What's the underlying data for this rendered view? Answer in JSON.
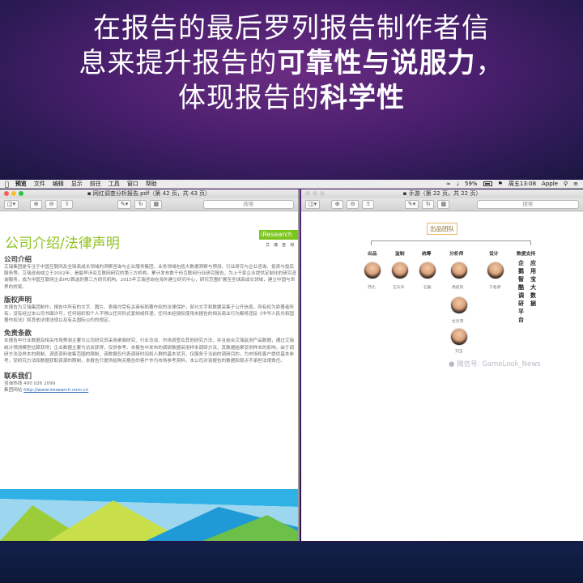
{
  "slide": {
    "headline_line1": "在报告的最后罗列报告制作者信",
    "headline_line2_a": "息来提升报告的",
    "headline_line2_b": "可靠性与说服力",
    "headline_line2_c": "，",
    "headline_line3_a": "体现报告的",
    "headline_line3_b": "科学性"
  },
  "menubar": {
    "apple": "",
    "items": [
      "预览",
      "文件",
      "编辑",
      "显示",
      "前往",
      "工具",
      "窗口",
      "帮助"
    ],
    "battery": "59%",
    "datetime": "周五13:08",
    "user": "Apple"
  },
  "left_window": {
    "title": "网红调查分析报告.pdf（第 42 页，共 43 页）",
    "search_placeholder": "搜索",
    "doc_title": "公司介绍/法律声明",
    "logo_text": "iResearch",
    "logo_sub": "艾瑞咨询",
    "sections": [
      {
        "heading": "公司介绍",
        "body": "艾瑞集团是专注于中国互联网及全球高成长领域的洞察咨询与企业服务集团，业务领域包括大数据洞察与预测、行业研究与企业咨询、投资与投后服务等。艾瑞咨询成立于2002年，是最早涉及互联网研究的第三方机构，累计发布数千份互联网行业研究报告，为上千家企业提供定制化的研究咨询服务，成为中国互联网企业IPO首选的第三方研究机构。2015年艾瑞咨询在海外建立研究中心，研究范围扩展至全球高成长领域，建立中国与世界的桥梁。"
      },
      {
        "heading": "版权声明",
        "body": "本报告为艾瑞集团制作，报告中所有的文字、图片、表格均受有关商标和著作权的法律保护，部分文字和数据采集于公开信息，所有权为原著者所有。没有经过本公司书面许可，任何组织和个人不得以任何形式复制或传递。任何未经授权使用本报告的相关商业行为都将违反《中华人民共和国著作权法》和其他法律法规以及有关国际公约的规定。"
      },
      {
        "heading": "免责条款",
        "body": "本报告中行业数据及相关市场预测主要为公司研究员采用桌面研究、行业访谈、市场调查及其他研究方法，并且结合艾瑞监测产品数据，通过艾瑞统计预测模型估算获得；企业数据主要为访谈获得，仅供参考。本报告中发布的调研数据采用样本调研方法，其数据结果受到样本的影响。由于调研方法及样本的限制，调查资料收集范围的限制，该数据仅代表调研时间和人群的基本状况，仅服务于当前的调研目的，为市场和客户提供基本参考。受研究方法和数据获取资源的限制，本报告只提供给购买报告的客户作为市场参考资料，本公司对该报告的数据和观点不承担法律责任。"
      }
    ],
    "contact": {
      "heading": "联系我们",
      "phone_label": "咨询热线",
      "phone": "400 026 2099",
      "site_label": "集团网站",
      "site": "http://www.iresearch.com.cn"
    }
  },
  "right_window": {
    "title": "手游（第 22 页，共 22 页）",
    "search_placeholder": "搜索",
    "team_title": "出品团队",
    "roles": [
      "出品",
      "监制",
      "统筹",
      "分析师",
      "设计",
      "数据支持"
    ],
    "names": [
      "苏北",
      "王乐华",
      "石磊",
      "杨俊凯",
      "于春源",
      "杜云雪",
      "刘玉"
    ],
    "data_support_col1": "企鹅智酷调研平台",
    "data_support_col2": "应用宝大数据",
    "watermark": "微信号: GameLook_News"
  }
}
